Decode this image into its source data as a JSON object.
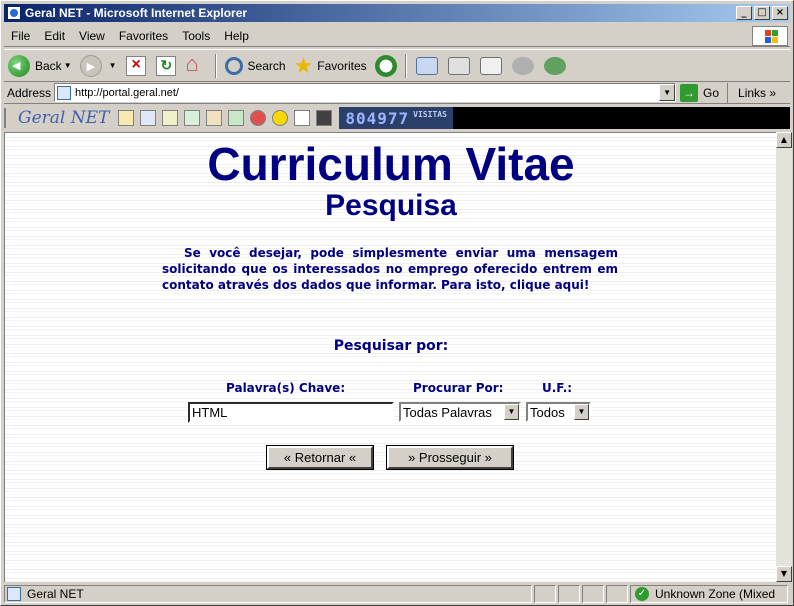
{
  "window": {
    "title": "Geral NET - Microsoft Internet Explorer",
    "min": "_",
    "max": "□",
    "close": "×"
  },
  "menu": [
    "File",
    "Edit",
    "View",
    "Favorites",
    "Tools",
    "Help"
  ],
  "toolbar": {
    "back": "Back",
    "search": "Search",
    "favorites": "Favorites"
  },
  "address": {
    "label": "Address",
    "url": "http://portal.geral.net/",
    "go": "Go",
    "links": "Links"
  },
  "geralbar": {
    "logo": "Geral NET",
    "counter": "804977",
    "counter_label": "VISITAS"
  },
  "page": {
    "title": "Curriculum Vitae",
    "subtitle": "Pesquisa",
    "intro": "Se você desejar, pode simplesmente enviar uma mensagem solicitando que os interessados no emprego oferecido entrem em contato através dos dados que informar. Para isto, clique aqui!",
    "search_heading": "Pesquisar por:",
    "labels": {
      "keywords": "Palavra(s) Chave:",
      "search_by": "Procurar Por:",
      "uf": "U.F.:"
    },
    "keywords_value": "HTML",
    "search_by_value": "Todas Palavras",
    "uf_value": "Todos",
    "back_button": "« Retornar «",
    "next_button": "» Prosseguir »"
  },
  "status": {
    "text": "Geral NET",
    "zone": "Unknown Zone (Mixed"
  }
}
